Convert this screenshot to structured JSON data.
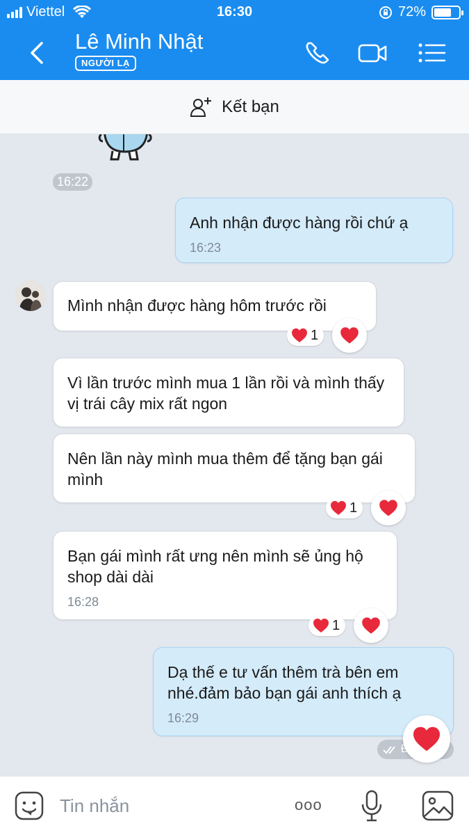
{
  "status": {
    "carrier": "Viettel",
    "time": "16:30",
    "battery": "72%",
    "battery_level": 0.72
  },
  "header": {
    "name": "Lê Minh Nhật",
    "badge": "NGƯỜI LẠ"
  },
  "add_friend": {
    "label": "Kết bạn"
  },
  "chat": {
    "prev_time": "16:22",
    "messages": [
      {
        "dir": "out",
        "text": "Anh nhận được hàng rồi chứ ạ",
        "time": "16:23"
      },
      {
        "dir": "in",
        "text": "Mình nhận được hàng hôm trước rồi",
        "reaction_count": "1"
      },
      {
        "dir": "in",
        "text": "Vì lần trước mình mua 1 lần rồi và mình thấy vị trái cây mix rất ngon"
      },
      {
        "dir": "in",
        "text": "Nên lần này mình mua thêm để tặng bạn gái mình",
        "reaction_count": "1"
      },
      {
        "dir": "in",
        "text": "Bạn gái mình rất ưng nên mình sẽ ủng hộ shop dài dài",
        "time": "16:28",
        "reaction_count": "1"
      },
      {
        "dir": "out",
        "text": "Dạ thế e tư vấn thêm trà bên em nhé.đảm bảo bạn gái anh thích ạ",
        "time": "16:29"
      }
    ],
    "delivery_status": "Đã nhận"
  },
  "input": {
    "placeholder": "Tin nhắn",
    "more_label": "ooo"
  },
  "colors": {
    "header_bg": "#1a8cf0",
    "bubble_out": "#d4ebfa",
    "bubble_in": "#ffffff",
    "heart": "#e8293b"
  }
}
